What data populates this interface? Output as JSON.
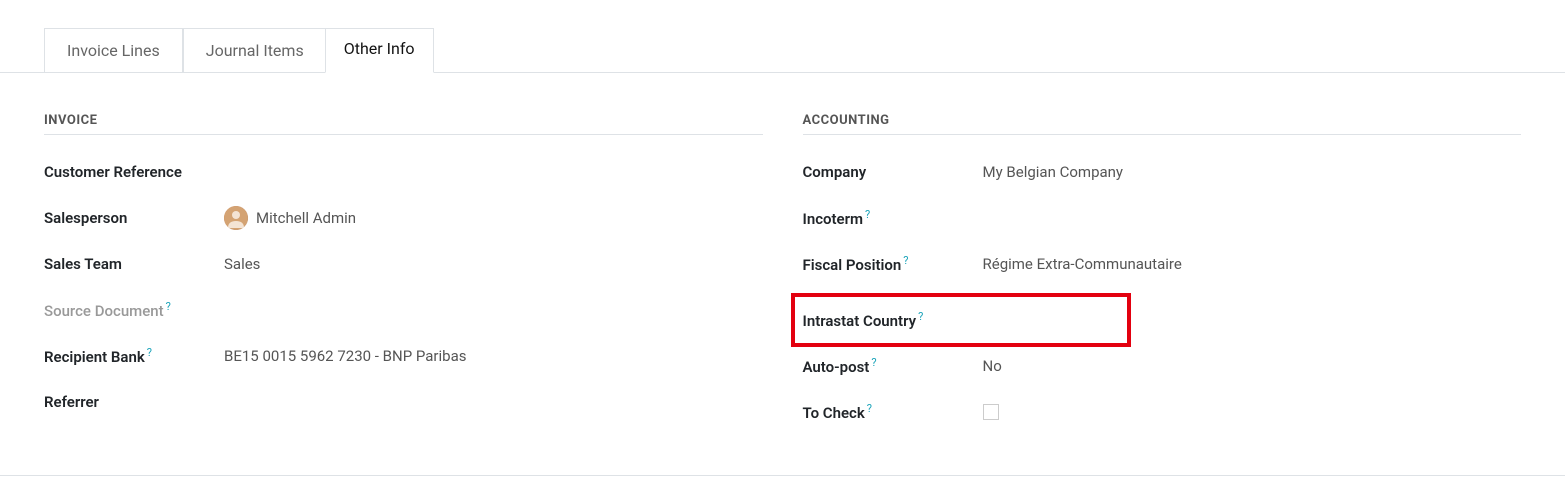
{
  "tabs": {
    "invoice_lines": "Invoice Lines",
    "journal_items": "Journal Items",
    "other_info": "Other Info"
  },
  "invoice_section": {
    "title": "INVOICE",
    "customer_reference_label": "Customer Reference",
    "customer_reference_value": "",
    "salesperson_label": "Salesperson",
    "salesperson_value": "Mitchell Admin",
    "sales_team_label": "Sales Team",
    "sales_team_value": "Sales",
    "source_document_label": "Source Document",
    "source_document_value": "",
    "recipient_bank_label": "Recipient Bank",
    "recipient_bank_value": "BE15 0015 5962 7230 - BNP Paribas",
    "referrer_label": "Referrer",
    "referrer_value": ""
  },
  "accounting_section": {
    "title": "ACCOUNTING",
    "company_label": "Company",
    "company_value": "My Belgian Company",
    "incoterm_label": "Incoterm",
    "incoterm_value": "",
    "fiscal_position_label": "Fiscal Position",
    "fiscal_position_value": "Régime Extra-Communautaire",
    "intrastat_country_label": "Intrastat Country",
    "intrastat_country_value": "",
    "auto_post_label": "Auto-post",
    "auto_post_value": "No",
    "to_check_label": "To Check",
    "to_check_checked": false
  },
  "help_marker": "?"
}
